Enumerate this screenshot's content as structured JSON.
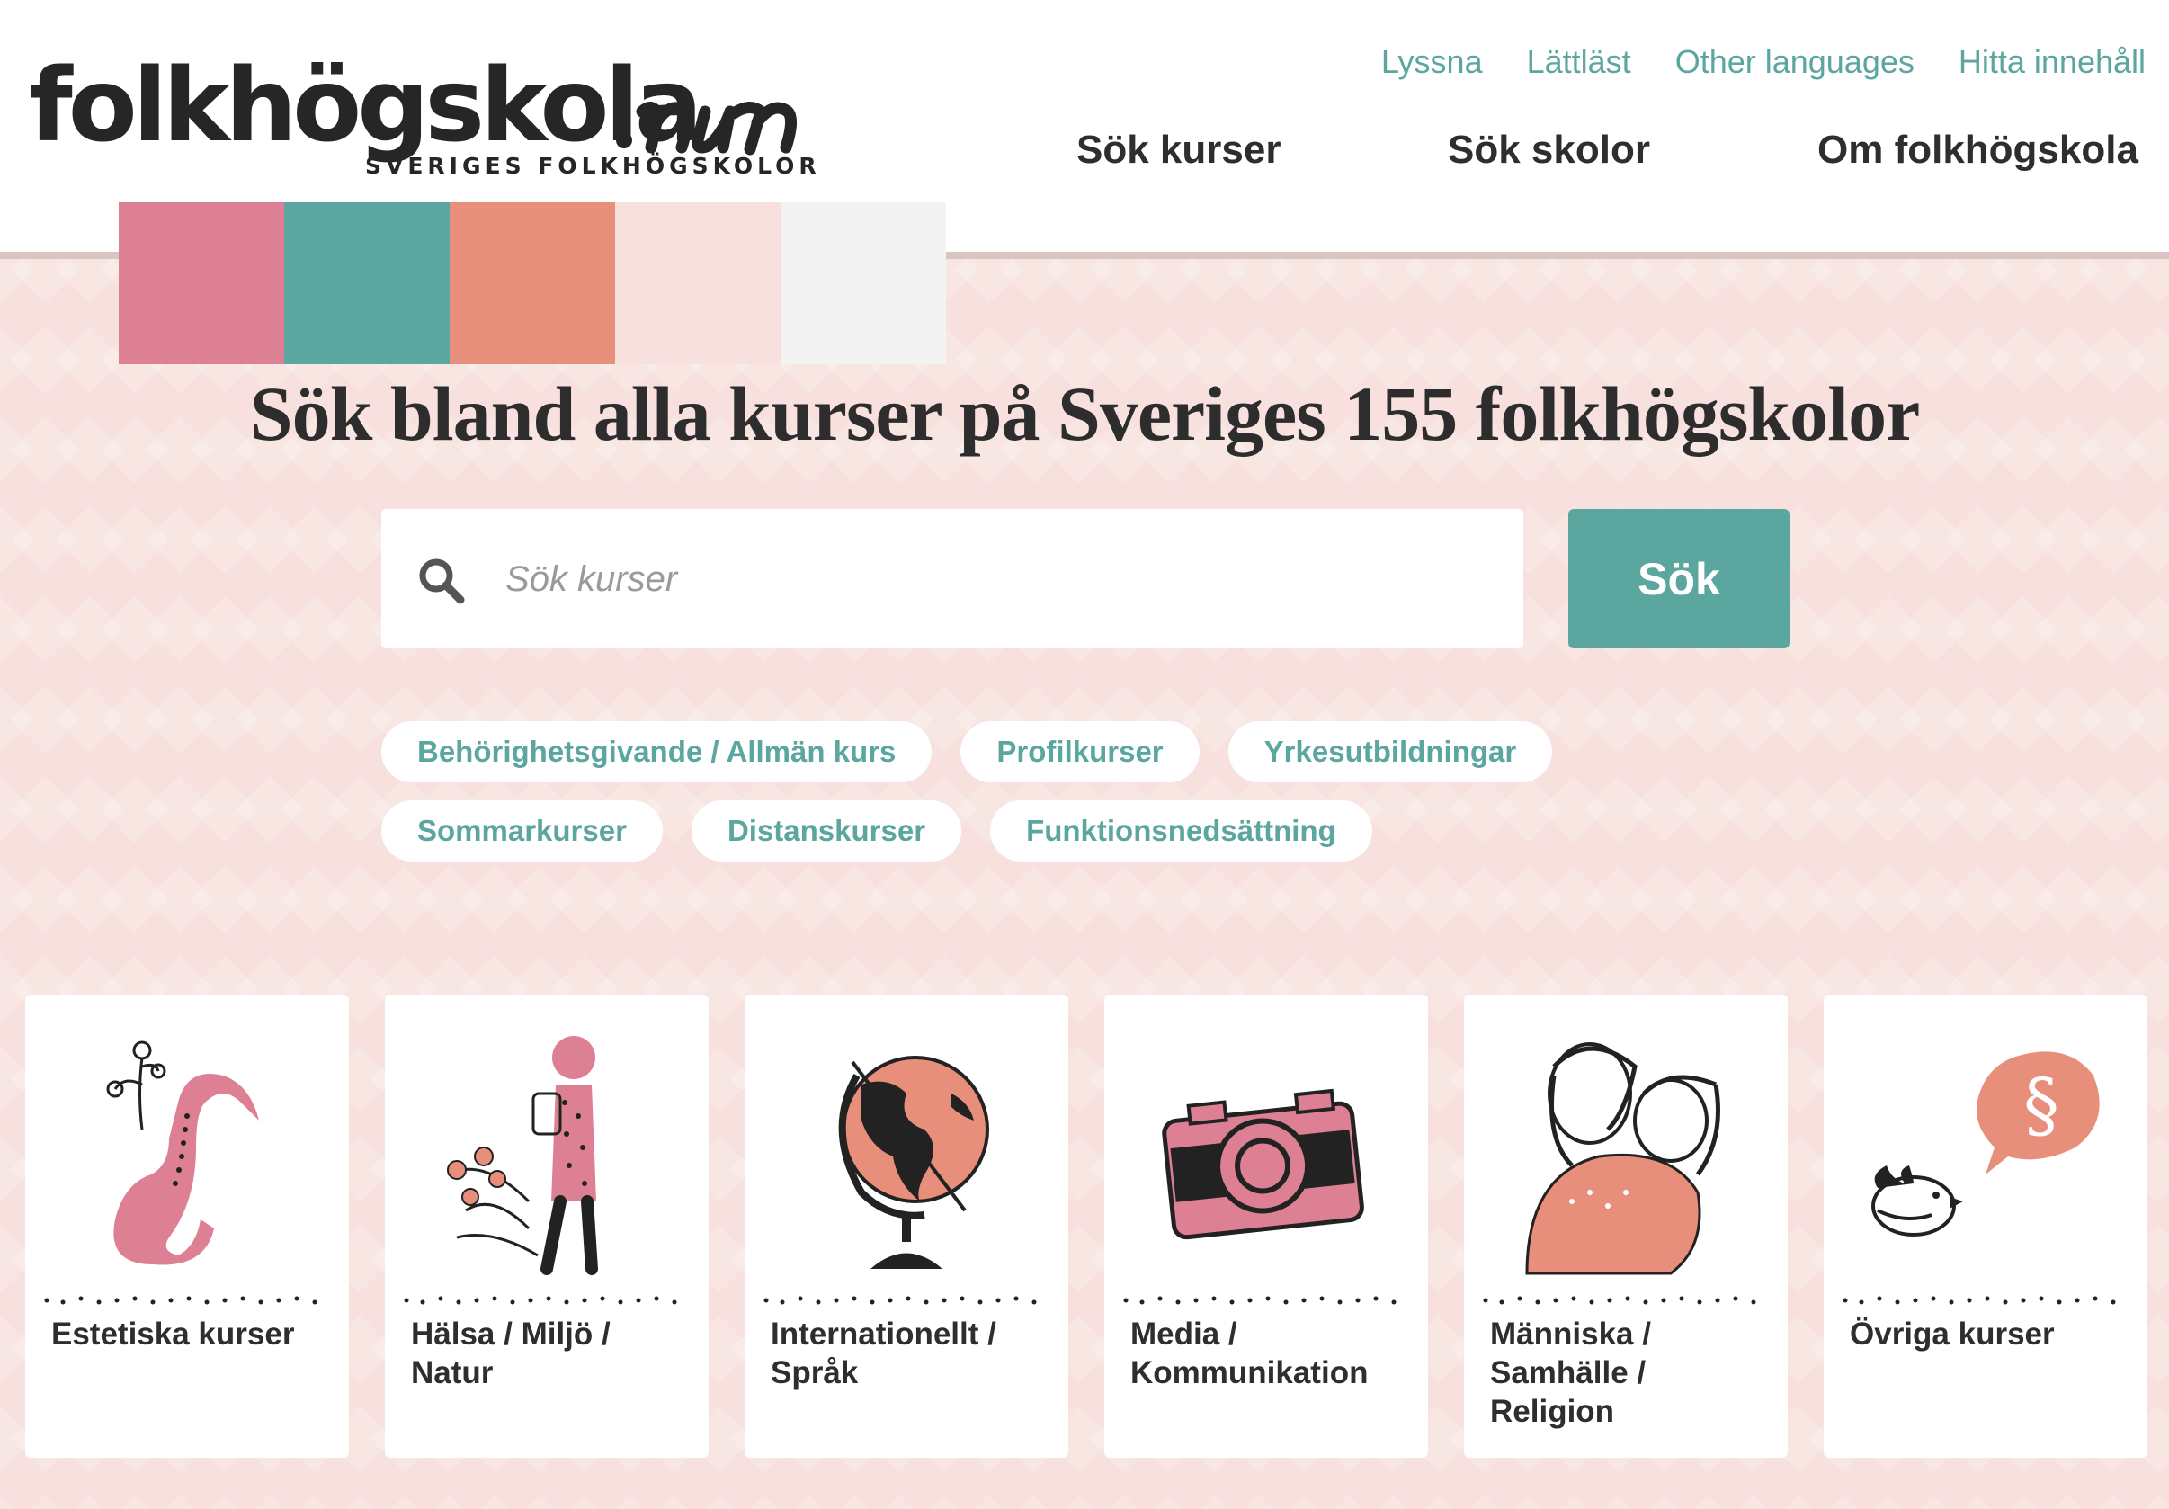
{
  "header": {
    "logo": {
      "wordmark": "folkhögskola",
      "suffix": ".nu",
      "tagline": "SVERIGES FOLKHÖGSKOLOR"
    },
    "util_nav": [
      "Lyssna",
      "Lättläst",
      "Other languages",
      "Hitta innehåll"
    ],
    "main_nav": [
      "Sök kurser",
      "Sök skolor",
      "Om folkhögskola"
    ]
  },
  "palette": [
    "#dd8094",
    "#5ba69f",
    "#e88f7b",
    "#f7e0dd",
    "#f3f3f3"
  ],
  "hero": {
    "title": "Sök bland alla kurser på Sveriges 155 folkhögskolor",
    "search_placeholder": "Sök kurser",
    "search_button": "Sök"
  },
  "tags": {
    "row1": [
      "Behörighetsgivande / Allmän kurs",
      "Profilkurser",
      "Yrkesutbildningar"
    ],
    "row2": [
      "Sommarkurser",
      "Distanskurser",
      "Funktionsnedsättning"
    ]
  },
  "categories": [
    {
      "label": "Estetiska kurser",
      "icon": "saxophone-icon"
    },
    {
      "label": "Hälsa / Miljö / Natur",
      "icon": "hiker-icon"
    },
    {
      "label": "Internationellt / Språk",
      "icon": "globe-icon"
    },
    {
      "label": "Media / Kommunikation",
      "icon": "camera-icon"
    },
    {
      "label": "Människa / Samhälle / Religion",
      "icon": "embrace-icon"
    },
    {
      "label": "Övriga kurser",
      "icon": "bird-speech-icon"
    }
  ],
  "colors": {
    "accent": "#5ba69f",
    "pink": "#dd8094",
    "coral": "#e88f7b",
    "background": "#f7e0dd"
  }
}
